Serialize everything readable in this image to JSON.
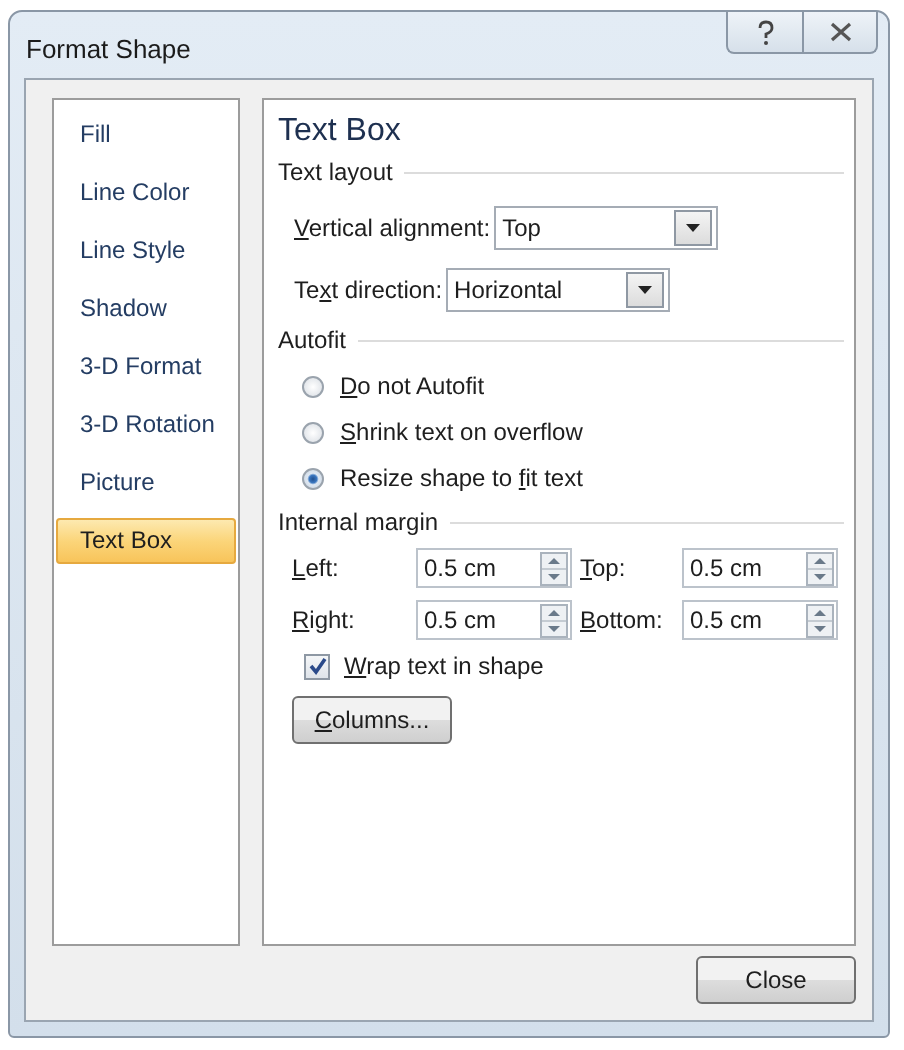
{
  "window": {
    "title": "Format Shape"
  },
  "sidebar": {
    "items": [
      {
        "label": "Fill",
        "selected": false
      },
      {
        "label": "Line Color",
        "selected": false
      },
      {
        "label": "Line Style",
        "selected": false
      },
      {
        "label": "Shadow",
        "selected": false
      },
      {
        "label": "3-D Format",
        "selected": false
      },
      {
        "label": "3-D Rotation",
        "selected": false
      },
      {
        "label": "Picture",
        "selected": false
      },
      {
        "label": "Text Box",
        "selected": true
      }
    ]
  },
  "panel": {
    "title": "Text Box",
    "text_layout": {
      "heading": "Text layout",
      "fields": [
        {
          "label": {
            "key": "V",
            "rest": "ertical alignment:"
          },
          "value": "Top"
        },
        {
          "label": {
            "pre": "Te",
            "key": "x",
            "rest": "t direction:"
          },
          "value": "Horizontal"
        }
      ]
    },
    "autofit": {
      "heading": "Autofit",
      "options": [
        {
          "label": {
            "key": "D",
            "rest": "o not Autofit"
          },
          "selected": false
        },
        {
          "label": {
            "key": "S",
            "rest": "hrink text on overflow"
          },
          "selected": false
        },
        {
          "label": {
            "pre": "Resize shape to ",
            "key": "f",
            "rest": "it text"
          },
          "selected": true
        }
      ]
    },
    "internal_margin": {
      "heading": "Internal margin",
      "fields": [
        {
          "label": {
            "key": "L",
            "rest": "eft:"
          },
          "value": "0.5 cm"
        },
        {
          "label": {
            "key": "T",
            "rest": "op:"
          },
          "value": "0.5 cm"
        },
        {
          "label": {
            "key": "R",
            "rest": "ight:"
          },
          "value": "0.5 cm"
        },
        {
          "label": {
            "key": "B",
            "rest": "ottom:"
          },
          "value": "0.5 cm"
        }
      ],
      "wrap": {
        "label": {
          "key": "W",
          "rest": "rap text in shape"
        },
        "checked": true
      }
    },
    "columns_button": {
      "label": {
        "key": "C",
        "rest": "olumns..."
      }
    }
  },
  "buttons": [
    "Close"
  ]
}
